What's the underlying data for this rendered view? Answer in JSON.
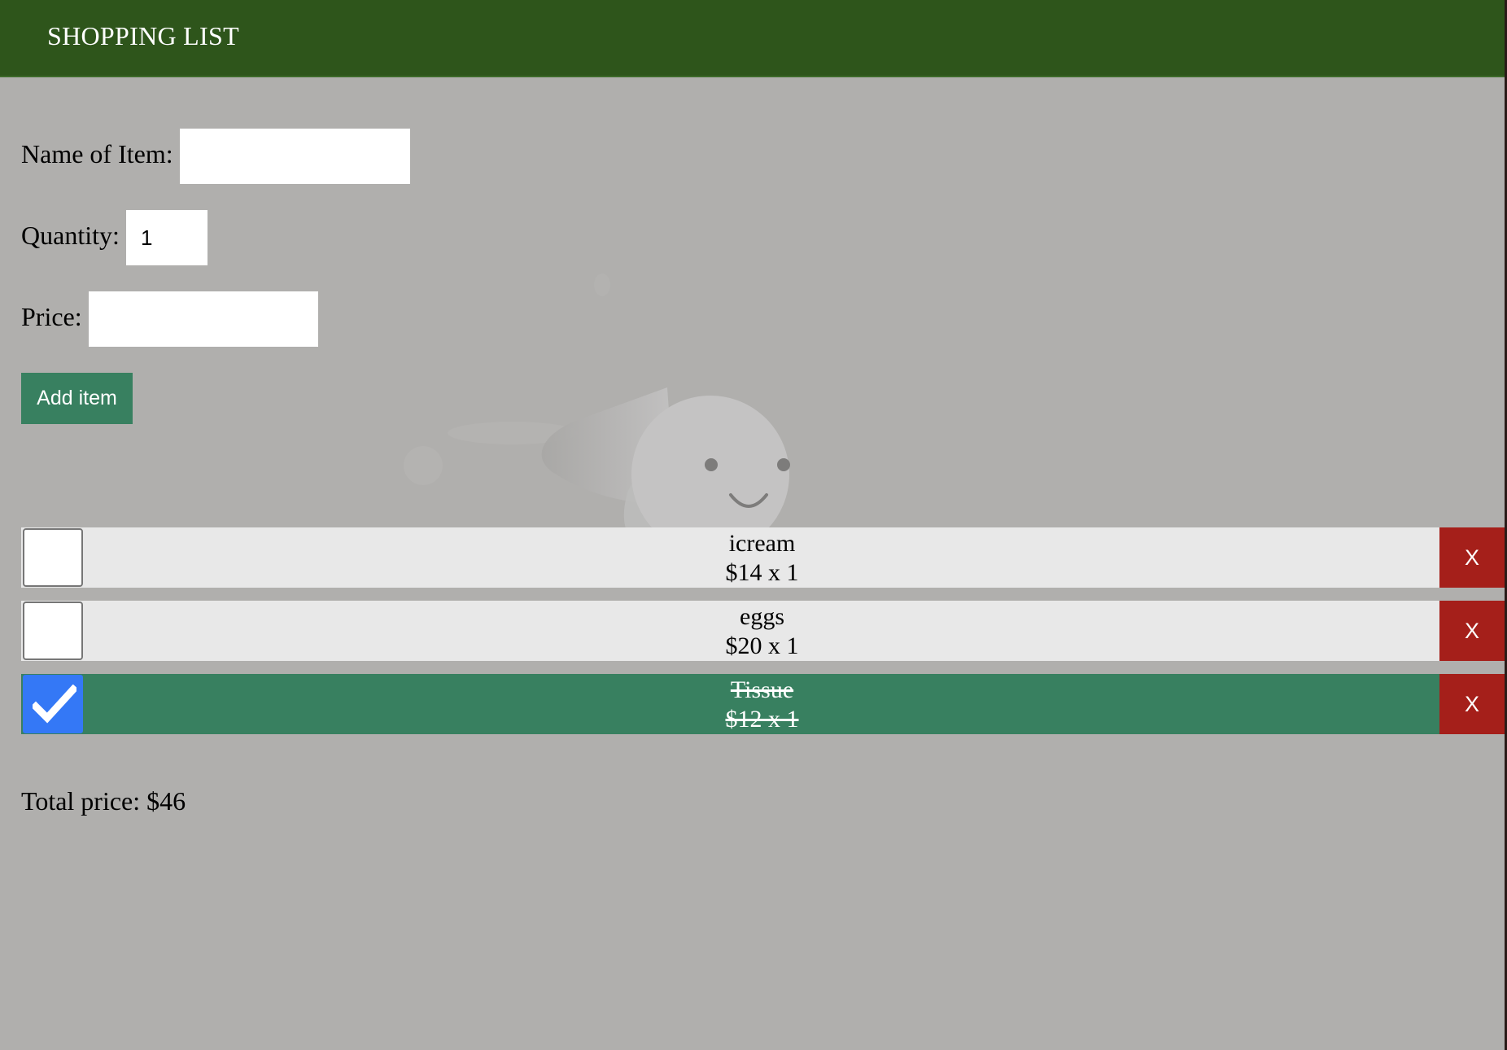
{
  "header": {
    "title": "SHOPPING LIST"
  },
  "form": {
    "name_label": "Name of Item:",
    "name_value": "",
    "quantity_label": "Quantity:",
    "quantity_value": "1",
    "price_label": "Price:",
    "price_value": "",
    "add_button_label": "Add item"
  },
  "items": [
    {
      "name": "icream",
      "price_line": "$14 x 1",
      "checked": false,
      "delete_label": "X"
    },
    {
      "name": "eggs",
      "price_line": "$20 x 1",
      "checked": false,
      "delete_label": "X"
    },
    {
      "name": "Tissue",
      "price_line": "$12 x 1",
      "checked": true,
      "delete_label": "X"
    }
  ],
  "total": {
    "text": "Total price: $46"
  },
  "colors": {
    "header": "#2e551b",
    "page_background": "#b0afad",
    "accent_green": "#388060",
    "delete_red": "#a51f1a",
    "checkbox_checked": "#3478f6",
    "item_background": "#e8e8e8"
  },
  "icons": {
    "mascot": "faded-cartoon-ghost-mascot",
    "check": "checkmark-icon"
  }
}
